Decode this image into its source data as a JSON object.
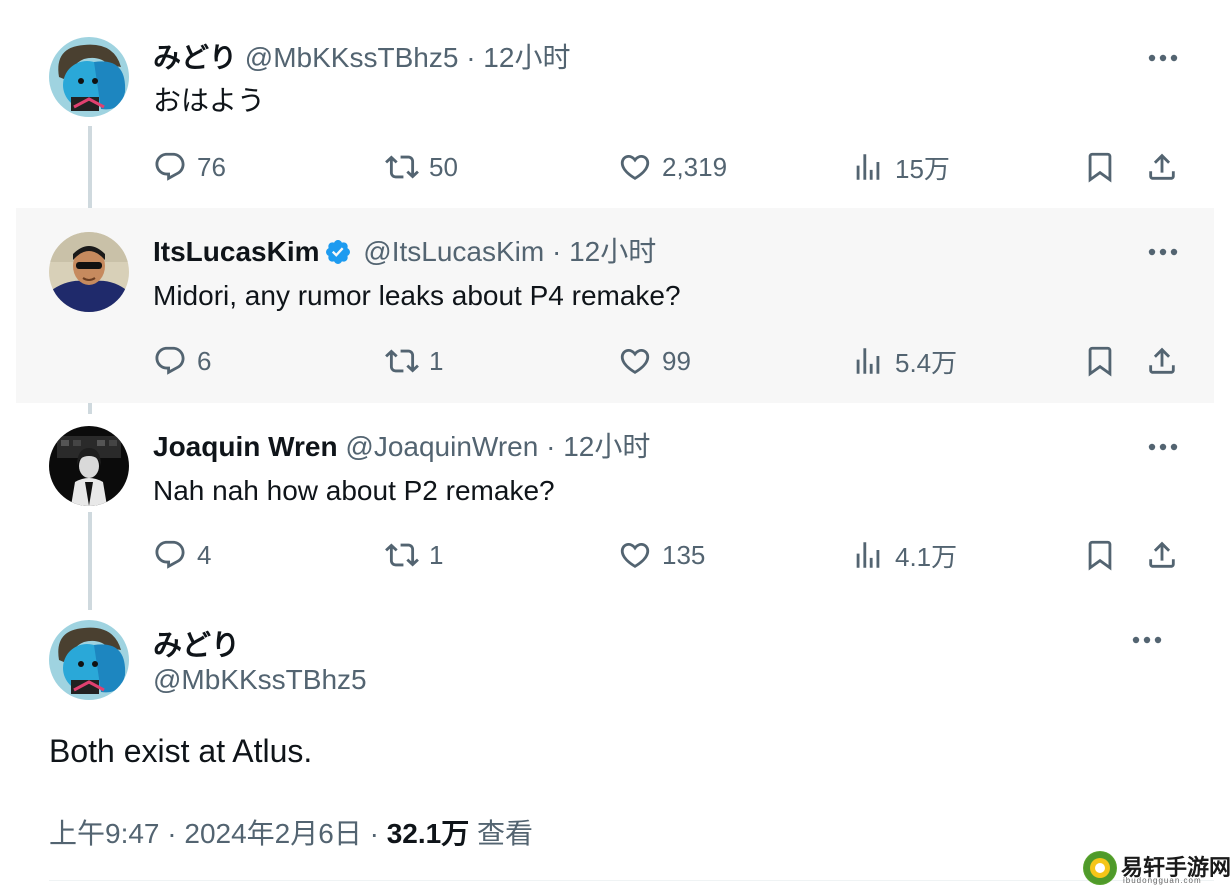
{
  "tweets": [
    {
      "name": "みどり",
      "handle": "@MbKKssTBhz5",
      "time": "12小时",
      "text": "おはよう",
      "replies": "76",
      "retweets": "50",
      "likes": "2,319",
      "views": "15万"
    },
    {
      "name": "ItsLucasKim",
      "handle": "@ItsLucasKim",
      "time": "12小时",
      "text": "Midori, any rumor leaks about P4 remake?",
      "replies": "6",
      "retweets": "1",
      "likes": "99",
      "views": "5.4万"
    },
    {
      "name": "Joaquin Wren",
      "handle": "@JoaquinWren",
      "time": "12小时",
      "text": "Nah nah how about P2 remake?",
      "replies": "4",
      "retweets": "1",
      "likes": "135",
      "views": "4.1万"
    }
  ],
  "separator": "·",
  "main": {
    "name": "みどり",
    "handle": "@MbKKssTBhz5",
    "text": "Both exist at Atlus.",
    "time": "上午9:47",
    "date": "2024年2月6日",
    "views_count": "32.1万",
    "views_label": "查看"
  },
  "watermark": {
    "title": "易轩手游网",
    "subtitle": "ibudongguan.com"
  },
  "colors": {
    "verified": "#1d9bf0",
    "secondary_text": "#536471",
    "highlight_bg": "#f7f7f7",
    "thread_line": "#cfd9de"
  }
}
